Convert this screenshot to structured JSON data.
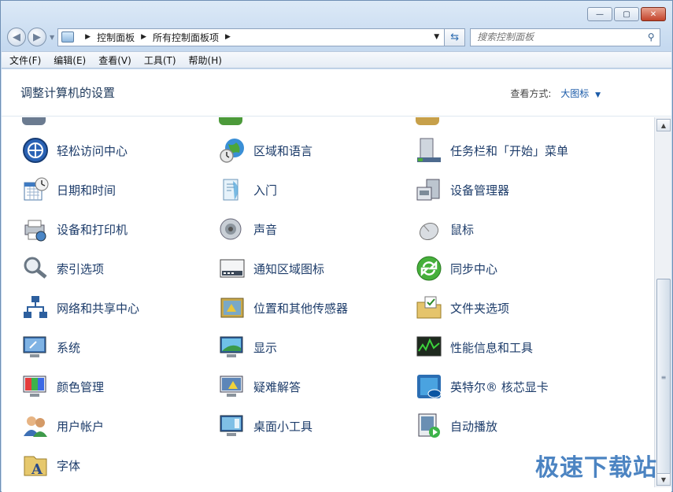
{
  "window": {
    "minimize": "—",
    "maximize": "▢",
    "close": "✕"
  },
  "address": {
    "crumbs": [
      "控制面板",
      "所有控制面板项"
    ],
    "search_placeholder": "搜索控制面板"
  },
  "menu": [
    "文件(F)",
    "编辑(E)",
    "查看(V)",
    "工具(T)",
    "帮助(H)"
  ],
  "header": {
    "title": "调整计算机的设置",
    "view_label": "查看方式:",
    "view_value": "大图标"
  },
  "items": [
    {
      "label": "轻松访问中心",
      "icon": "ease-of-access-icon"
    },
    {
      "label": "区域和语言",
      "icon": "globe-clock-icon"
    },
    {
      "label": "任务栏和「开始」菜单",
      "icon": "taskbar-icon"
    },
    {
      "label": "日期和时间",
      "icon": "calendar-clock-icon"
    },
    {
      "label": "入门",
      "icon": "getting-started-icon"
    },
    {
      "label": "设备管理器",
      "icon": "device-manager-icon"
    },
    {
      "label": "设备和打印机",
      "icon": "printer-icon"
    },
    {
      "label": "声音",
      "icon": "speaker-icon"
    },
    {
      "label": "鼠标",
      "icon": "mouse-icon"
    },
    {
      "label": "索引选项",
      "icon": "magnifier-icon"
    },
    {
      "label": "通知区域图标",
      "icon": "notification-area-icon"
    },
    {
      "label": "同步中心",
      "icon": "sync-icon"
    },
    {
      "label": "网络和共享中心",
      "icon": "network-icon"
    },
    {
      "label": "位置和其他传感器",
      "icon": "location-sensor-icon"
    },
    {
      "label": "文件夹选项",
      "icon": "folder-options-icon"
    },
    {
      "label": "系统",
      "icon": "system-icon"
    },
    {
      "label": "显示",
      "icon": "display-icon"
    },
    {
      "label": "性能信息和工具",
      "icon": "performance-icon"
    },
    {
      "label": "颜色管理",
      "icon": "color-management-icon"
    },
    {
      "label": "疑难解答",
      "icon": "troubleshooting-icon"
    },
    {
      "label": "英特尔® 核芯显卡",
      "icon": "intel-graphics-icon"
    },
    {
      "label": "用户帐户",
      "icon": "user-accounts-icon"
    },
    {
      "label": "桌面小工具",
      "icon": "gadgets-icon"
    },
    {
      "label": "自动播放",
      "icon": "autoplay-icon"
    },
    {
      "label": "字体",
      "icon": "fonts-icon"
    }
  ],
  "watermark": "极速下载站"
}
